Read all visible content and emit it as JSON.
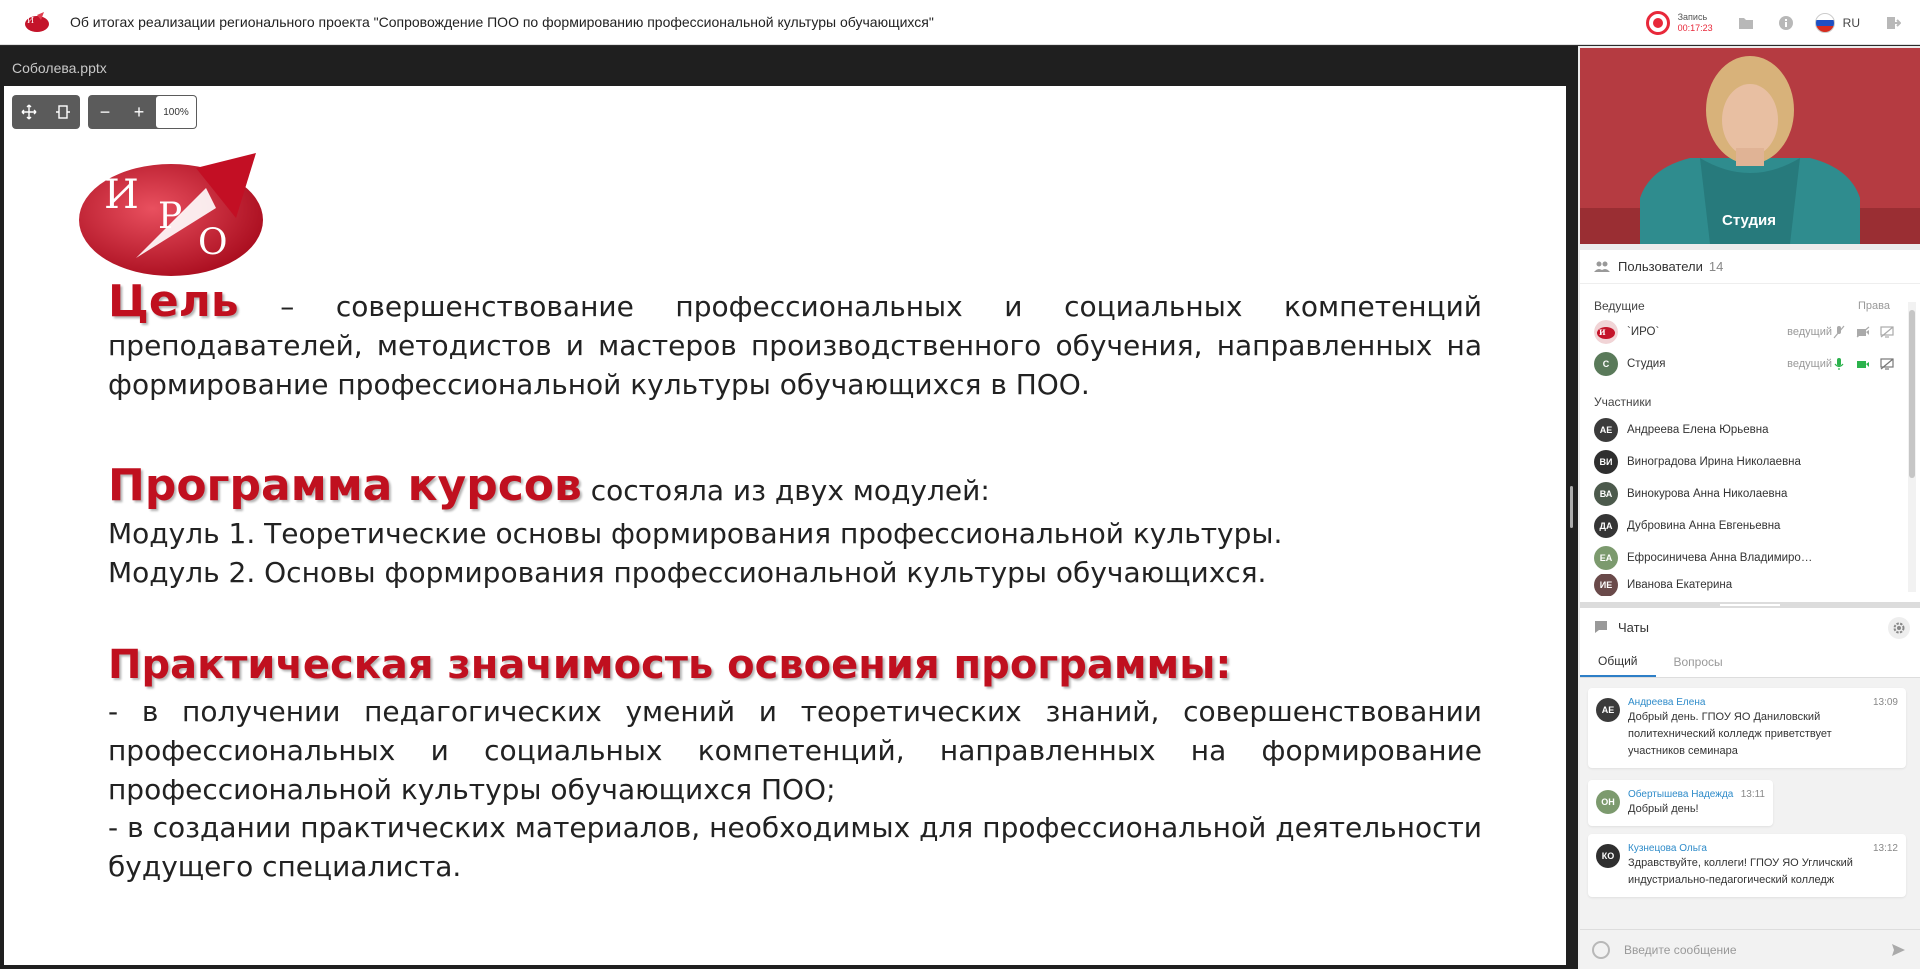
{
  "header": {
    "title": "Об итогах реализации регионального проекта \"Сопровождение ПОО по формированию профессиональной культуры обучающихся\"",
    "record_label": "Запись",
    "record_time": "00:17:23",
    "language": "RU"
  },
  "presentation": {
    "file_name": "Соболева.pptx",
    "zoom": "100%",
    "zoom_out": "−",
    "zoom_in": "+"
  },
  "slide": {
    "heading_goal": "Цель",
    "goal_text": " – совершенствование профессиональных и социальных  компетенций преподавателей, методистов и мастеров производственного обучения, направленных на формирование профессиональной культуры обучающихся в ПОО.",
    "heading_program": "Программа курсов",
    "program_text": " состояла из двух модулей:",
    "module1": "Модуль 1. Теоретические основы формирования профессиональной культуры.",
    "module2": "Модуль 2. Основы формирования профессиональной культуры обучающихся.",
    "heading_practical": "Практическая значимость освоения программы:",
    "practical_1": "- в получении педагогических умений и теоретических знаний, совершенствовании профессиональных и социальных компетенций, направленных на формирование профессиональной культуры обучающихся ПОО;",
    "practical_2": "- в создании практических материалов, необходимых для профессиональной деятельности будущего специалиста."
  },
  "video": {
    "label": "Студия"
  },
  "users": {
    "title": "Пользователи",
    "count": "14",
    "hosts_label": "Ведущие",
    "rights_label": "Права",
    "participants_label": "Участники",
    "hosts": [
      {
        "initials": "",
        "name": "`ИРО`",
        "role": "ведущий"
      },
      {
        "initials": "С",
        "name": "Студия",
        "role": "ведущий"
      }
    ],
    "participants": [
      {
        "initials": "АЕ",
        "name": "Андреева Елена Юрьевна"
      },
      {
        "initials": "ВИ",
        "name": "Виноградова Ирина Николаевна"
      },
      {
        "initials": "ВА",
        "name": "Винокурова Анна Николаевна"
      },
      {
        "initials": "ДА",
        "name": "Дубровина Анна Евгеньевна"
      },
      {
        "initials": "ЕА",
        "name": "Ефросиничева Анна Владимиро…"
      },
      {
        "initials": "ИЕ",
        "name": "Иванова Екатерина"
      }
    ]
  },
  "chats": {
    "title": "Чаты",
    "tabs": [
      "Общий",
      "Вопросы"
    ],
    "messages": [
      {
        "initials": "АЕ",
        "author": "Андреева Елена",
        "time": "13:09",
        "text": "Добрый день. ГПОУ ЯО Даниловский политехнический колледж приветствует участников семинара"
      },
      {
        "initials": "ОН",
        "author": "Обертышева Надежда",
        "time": "13:11",
        "text": "Добрый день!"
      },
      {
        "initials": "КО",
        "author": "Кузнецова Ольга",
        "time": "13:12",
        "text": "Здравствуйте, коллеги! ГПОУ ЯО Угличский индустриально-педагогический колледж"
      }
    ],
    "input_placeholder": "Введите сообщение"
  },
  "colors": {
    "accent_red": "#c0101f",
    "record_red": "#e8283a",
    "link_blue": "#2e8bc9",
    "mic_on_green": "#2bb24c"
  }
}
